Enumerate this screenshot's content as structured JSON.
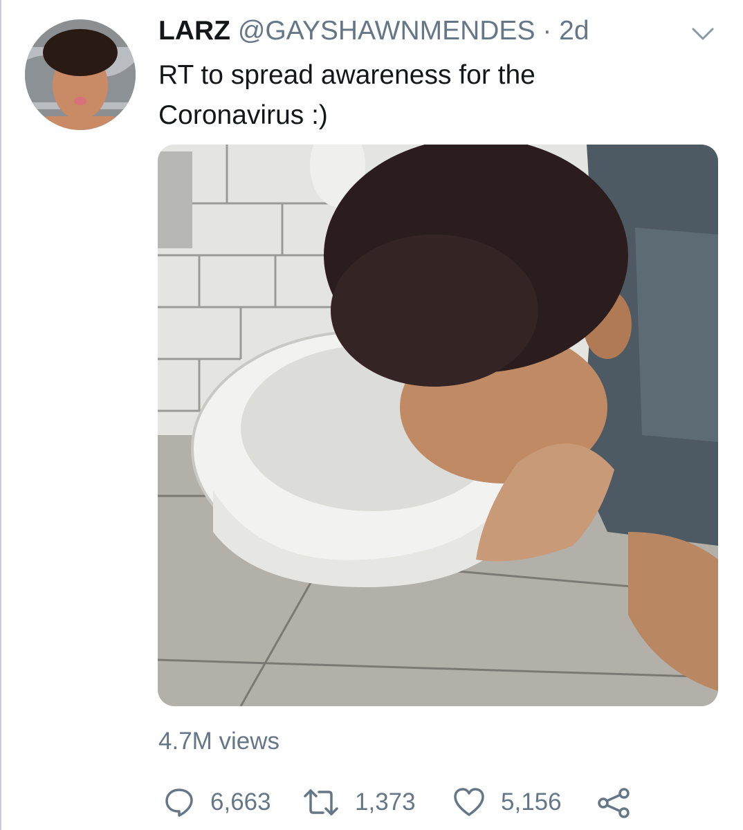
{
  "tweet": {
    "display_name": "LARZ",
    "handle": "@GAYSHAWNMENDES",
    "separator": "·",
    "time": "2d",
    "text_line1": "RT to spread awareness for the",
    "text_line2": "Coronavirus :)",
    "views": "4.7M views"
  },
  "actions": {
    "replies": "6,663",
    "retweets": "1,373",
    "likes": "5,156"
  },
  "icons": {
    "more": "chevron-down-icon",
    "reply": "reply-icon",
    "retweet": "retweet-icon",
    "like": "heart-icon",
    "share": "share-icon"
  },
  "colors": {
    "text": "#14171a",
    "secondary": "#657786"
  }
}
